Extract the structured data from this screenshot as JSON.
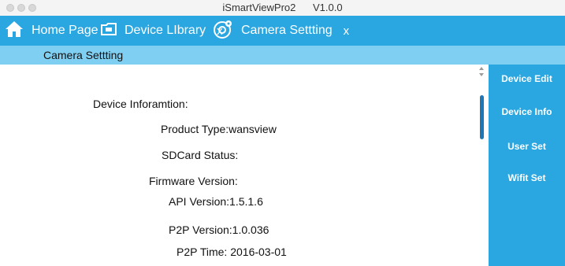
{
  "window": {
    "app_name": "iSmartViewPro2",
    "version": "V1.0.0"
  },
  "tabs": [
    {
      "label": "Home Page",
      "icon": "home-icon"
    },
    {
      "label": "Device LIbrary",
      "icon": "device-library-icon",
      "close": "x"
    },
    {
      "label": "Camera Settting",
      "icon": "camera-settings-icon",
      "close": "x"
    }
  ],
  "breadcrumb": {
    "label": "Camera Settting"
  },
  "info": {
    "heading": "Device Inforamtion:",
    "product_type": "Product Type:wansview",
    "sdcard_status": "SDCard Status:",
    "firmware_version": "Firmware Version:",
    "api_version": "API Version:1.5.1.6",
    "p2p_version": "P2P Version:1.0.036",
    "p2p_time": "P2P Time: 2016-03-01"
  },
  "sidebar": {
    "items": [
      {
        "label": "Device Edit"
      },
      {
        "label": "Device Info"
      },
      {
        "label": "User Set"
      },
      {
        "label": "Wifit Set"
      }
    ]
  },
  "colors": {
    "accent": "#2aa6e0",
    "subbar": "#7fcff3",
    "scroll_thumb": "#1f78b4"
  }
}
